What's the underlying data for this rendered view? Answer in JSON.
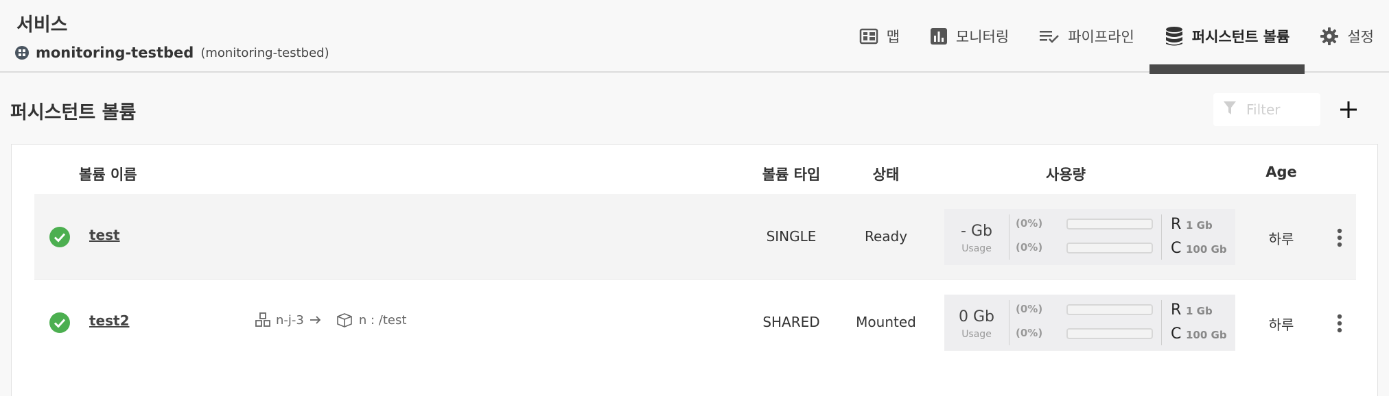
{
  "header": {
    "service_title": "서비스",
    "project_name": "monitoring-testbed",
    "project_namespace": "(monitoring-testbed)",
    "tabs": [
      {
        "label": "맵",
        "icon": "dashboard-icon"
      },
      {
        "label": "모니터링",
        "icon": "bar-chart-icon"
      },
      {
        "label": "파이프라인",
        "icon": "playlist-check-icon"
      },
      {
        "label": "퍼시스턴트 볼륨",
        "icon": "database-icon",
        "active": true
      },
      {
        "label": "설정",
        "icon": "gear-icon"
      }
    ]
  },
  "page": {
    "title": "퍼시스턴트 볼륨",
    "filter_placeholder": "Filter",
    "add_label": "+"
  },
  "table": {
    "columns": [
      "볼륨 이름",
      "볼륨 타입",
      "상태",
      "사용량",
      "Age"
    ],
    "rows": [
      {
        "name": "test",
        "node": "",
        "mount": "",
        "type": "SINGLE",
        "status": "Ready",
        "usage_value": "- Gb",
        "usage_label": "Usage",
        "r_pct": "(0%)",
        "c_pct": "(0%)",
        "r_fill": 0,
        "c_fill": 0,
        "r_letter": "R",
        "r_value": "1 Gb",
        "c_letter": "C",
        "c_value": "100 Gb",
        "age": "하루"
      },
      {
        "name": "test2",
        "node": "n-j-3",
        "mount": "n : /test",
        "type": "SHARED",
        "status": "Mounted",
        "usage_value": "0 Gb",
        "usage_label": "Usage",
        "r_pct": "(0%)",
        "c_pct": "(0%)",
        "r_fill": 0,
        "c_fill": 0,
        "r_letter": "R",
        "r_value": "1 Gb",
        "c_letter": "C",
        "c_value": "100 Gb",
        "age": "하루"
      }
    ]
  },
  "colors": {
    "ok_green": "#4caf50",
    "active_tab_bar": "#4a4a4a"
  }
}
